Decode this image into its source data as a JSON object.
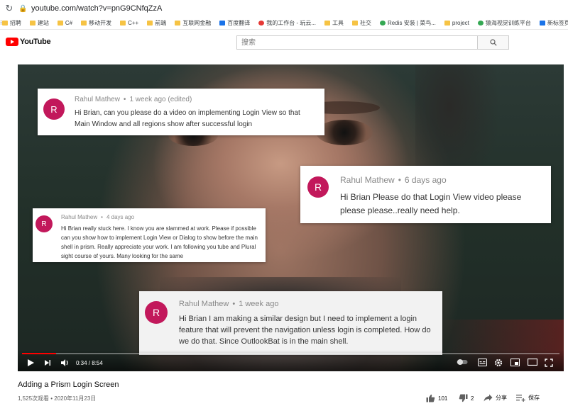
{
  "browser": {
    "url": "youtube.com/watch?v=pnG9CNfqZzA",
    "bookmarks": [
      "招聘",
      "建站",
      "C#",
      "移动开发",
      "C++",
      "前端",
      "互联网金融",
      "百度翻译",
      "我的工作台 - 玩云...",
      "工具",
      "社交",
      "Redis 安装 | 菜鸟...",
      "project",
      "猿海视觉训练平台",
      "新标签页"
    ]
  },
  "header": {
    "logo_text": "YouTube",
    "search_placeholder": "搜索"
  },
  "video": {
    "comments": [
      {
        "avatar": "R",
        "author": "Rahul Mathew",
        "time": "1 week ago (edited)",
        "text": "Hi Brian, can you please do a video on implementing Login View so that Main Window and all regions show after successful login"
      },
      {
        "avatar": "R",
        "author": "Rahul Mathew",
        "time": "6 days ago",
        "text": "Hi Brian Please do that Login View video please please please..really need help."
      },
      {
        "avatar": "R",
        "author": "Rahul Mathew",
        "time": "4 days ago",
        "text": "Hi Brian really stuck here. I know you are slammed at work. Please if possible can you show how to implement Login View or Dialog to show before the main shell in prism. Really appreciate your work. I am following you tube and Plural sight course of yours. Many looking for the same"
      },
      {
        "avatar": "R",
        "author": "Rahul Mathew",
        "time": "1 week ago",
        "text": "Hi Brian I am making a similar design but I need to implement a login feature that will prevent the navigation unless login is  completed. How do we do that. Since OutlookBat is in the main shell."
      }
    ],
    "player": {
      "current_time": "0:34",
      "duration": "8:54",
      "time_display": "0:34 / 8:54",
      "progress": 0.064
    }
  },
  "info": {
    "title": "Adding a Prism Login Screen",
    "stats": "1,525次观看 • 2020年11月23日",
    "likes": "101",
    "dislikes": "2",
    "share_label": "分享",
    "save_label": "保存"
  },
  "colors": {
    "avatar": "#c2185b",
    "progress": "#ff0000",
    "yt_red": "#ff0000"
  }
}
